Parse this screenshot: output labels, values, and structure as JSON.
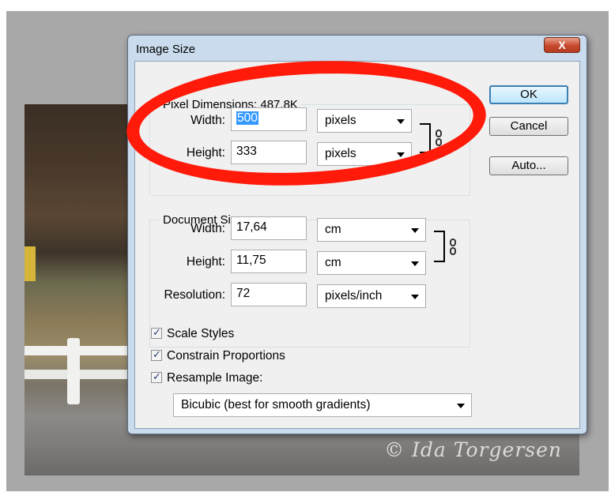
{
  "window": {
    "title": "Image Size",
    "close_glyph": "X"
  },
  "pixel_dimensions": {
    "legend": "Pixel Dimensions:  487,8K",
    "width_label": "Width:",
    "width_value": "500",
    "width_unit": "pixels",
    "height_label": "Height:",
    "height_value": "333",
    "height_unit": "pixels"
  },
  "document_size": {
    "legend": "Document Size:",
    "width_label": "Width:",
    "width_value": "17,64",
    "width_unit": "cm",
    "height_label": "Height:",
    "height_value": "11,75",
    "height_unit": "cm",
    "resolution_label": "Resolution:",
    "resolution_value": "72",
    "resolution_unit": "pixels/inch"
  },
  "buttons": {
    "ok": "OK",
    "cancel": "Cancel",
    "auto": "Auto..."
  },
  "options": {
    "scale_styles": "Scale Styles",
    "constrain_proportions": "Constrain Proportions",
    "resample_image": "Resample Image:",
    "resample_method": "Bicubic (best for smooth gradients)",
    "scale_styles_checked": true,
    "constrain_proportions_checked": true,
    "resample_image_checked": true
  },
  "photo": {
    "watermark": "© Ida Torgersen"
  },
  "colors": {
    "annotation_red": "#ff1a0a",
    "default_button": "#bde6fd"
  },
  "icons": [
    "close-icon",
    "link-chain-icon",
    "dropdown-arrow-icon",
    "checkmark-icon"
  ]
}
